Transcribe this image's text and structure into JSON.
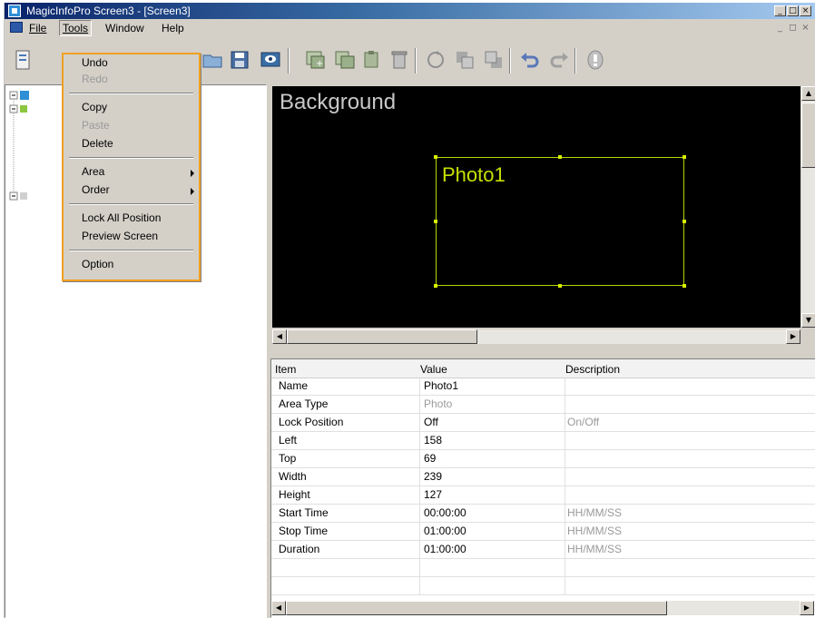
{
  "window": {
    "title": "MagicInfoPro Screen3 - [Screen3]"
  },
  "menubar": {
    "items": [
      "File",
      "Tools",
      "Window",
      "Help"
    ],
    "active": "Tools"
  },
  "tools_menu": {
    "items": [
      {
        "label": "Undo",
        "enabled": true
      },
      {
        "label": "Redo",
        "enabled": false
      },
      {
        "label": "Copy",
        "enabled": true
      },
      {
        "label": "Paste",
        "enabled": false
      },
      {
        "label": "Delete",
        "enabled": true
      },
      {
        "label": "Area",
        "enabled": true,
        "submenu": true
      },
      {
        "label": "Order",
        "enabled": true,
        "submenu": true
      },
      {
        "label": "Lock All Position",
        "enabled": true
      },
      {
        "label": "Preview Screen",
        "enabled": true
      },
      {
        "label": "Option",
        "enabled": true
      }
    ]
  },
  "canvas": {
    "background_label": "Background",
    "area_label": "Photo1"
  },
  "properties": {
    "columns": [
      "Item",
      "Value",
      "Description"
    ],
    "rows": [
      {
        "item": "Name",
        "value": "Photo1",
        "description": ""
      },
      {
        "item": "Area Type",
        "value": "Photo",
        "description": ""
      },
      {
        "item": "Lock Position",
        "value": "Off",
        "description": "On/Off"
      },
      {
        "item": "Left",
        "value": "158",
        "description": ""
      },
      {
        "item": "Top",
        "value": "69",
        "description": ""
      },
      {
        "item": "Width",
        "value": "239",
        "description": ""
      },
      {
        "item": "Height",
        "value": "127",
        "description": ""
      },
      {
        "item": "Start Time",
        "value": "00:00:00",
        "description": "HH/MM/SS"
      },
      {
        "item": "Stop Time",
        "value": "01:00:00",
        "description": "HH/MM/SS"
      },
      {
        "item": "Duration",
        "value": "01:00:00",
        "description": "HH/MM/SS"
      }
    ]
  },
  "colors": {
    "area_outline": "#b8d400",
    "area_text": "#c6e000",
    "menu_highlight_border": "#f0a020",
    "titlebar": "#0a246a"
  }
}
